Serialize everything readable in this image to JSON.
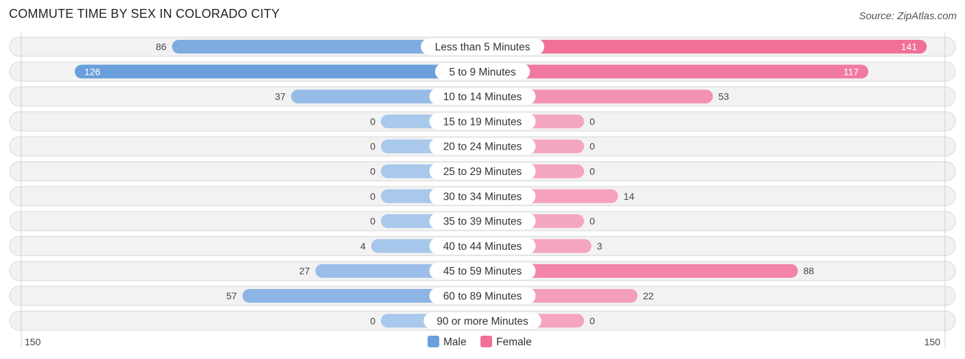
{
  "header": {
    "title": "COMMUTE TIME BY SEX IN COLORADO CITY",
    "source": "Source: ZipAtlas.com"
  },
  "colors": {
    "male_strong": "#6a9fdc",
    "male_light": "#a8c8ec",
    "female_strong": "#f07098",
    "female_light": "#f5a6bf"
  },
  "chart_data": {
    "type": "bar",
    "orientation": "horizontal-diverging",
    "title": "COMMUTE TIME BY SEX IN COLORADO CITY",
    "categories": [
      "Less than 5 Minutes",
      "5 to 9 Minutes",
      "10 to 14 Minutes",
      "15 to 19 Minutes",
      "20 to 24 Minutes",
      "25 to 29 Minutes",
      "30 to 34 Minutes",
      "35 to 39 Minutes",
      "40 to 44 Minutes",
      "45 to 59 Minutes",
      "60 to 89 Minutes",
      "90 or more Minutes"
    ],
    "series": [
      {
        "name": "Male",
        "values": [
          86,
          126,
          37,
          0,
          0,
          0,
          0,
          0,
          4,
          27,
          57,
          0
        ]
      },
      {
        "name": "Female",
        "values": [
          141,
          117,
          53,
          0,
          0,
          0,
          14,
          0,
          3,
          88,
          22,
          0
        ]
      }
    ],
    "axis": {
      "left_max_label": "150",
      "right_max_label": "150",
      "range": [
        150,
        150
      ]
    },
    "legend": {
      "placement": "bottom-center",
      "entries": [
        "Male",
        "Female"
      ]
    },
    "grid": false
  }
}
